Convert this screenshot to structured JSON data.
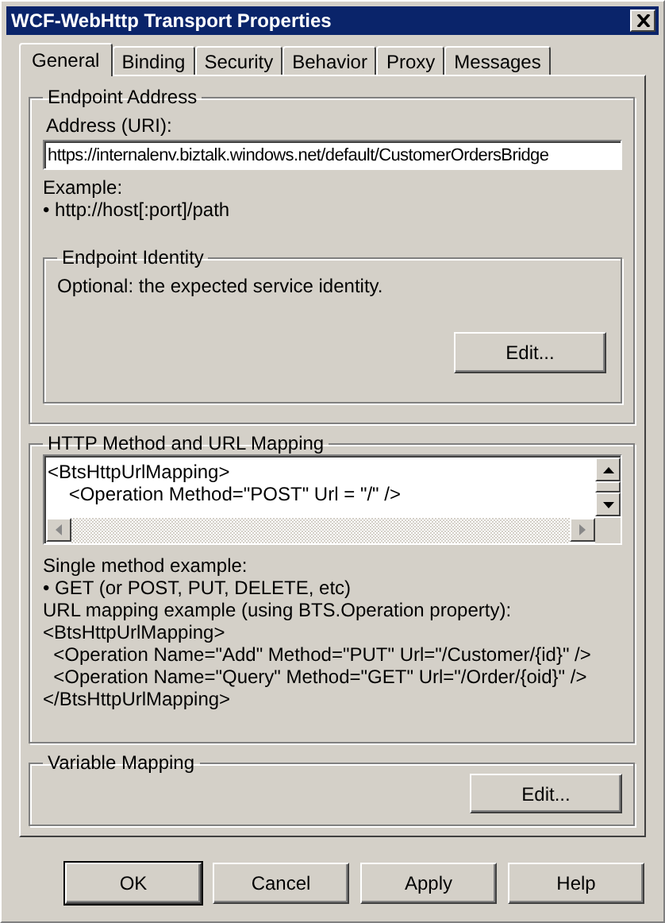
{
  "window": {
    "title": "WCF-WebHttp Transport Properties"
  },
  "tabs": [
    {
      "label": "General",
      "selected": true
    },
    {
      "label": "Binding",
      "selected": false
    },
    {
      "label": "Security",
      "selected": false
    },
    {
      "label": "Behavior",
      "selected": false
    },
    {
      "label": "Proxy",
      "selected": false
    },
    {
      "label": "Messages",
      "selected": false
    }
  ],
  "endpoint_address": {
    "title": "Endpoint Address",
    "address_label": "Address (URI):",
    "address_value": "https://internalenv.biztalk.windows.net/default/CustomerOrdersBridge",
    "example_lines": [
      "Example:",
      "• http://host[:port]/path"
    ],
    "identity": {
      "title": "Endpoint Identity",
      "text": "Optional: the expected service identity.",
      "button": "Edit..."
    }
  },
  "http_mapping": {
    "title": "HTTP Method and URL Mapping",
    "editor_lines": [
      "<BtsHttpUrlMapping>",
      "    <Operation Method=\"POST\" Url = \"/\" />"
    ],
    "help_lines": [
      "Single method example:",
      "• GET (or POST, PUT, DELETE, etc)",
      "URL mapping example (using BTS.Operation property):",
      "<BtsHttpUrlMapping>",
      "  <Operation Name=\"Add\" Method=\"PUT\" Url=\"/Customer/{id}\" />",
      "  <Operation Name=\"Query\" Method=\"GET\" Url=\"/Order/{oid}\" />",
      "</BtsHttpUrlMapping>"
    ]
  },
  "variable_mapping": {
    "title": "Variable Mapping",
    "button": "Edit..."
  },
  "buttons": [
    {
      "label": "OK",
      "default": true
    },
    {
      "label": "Cancel",
      "default": false
    },
    {
      "label": "Apply",
      "default": false
    },
    {
      "label": "Help",
      "default": false
    }
  ]
}
